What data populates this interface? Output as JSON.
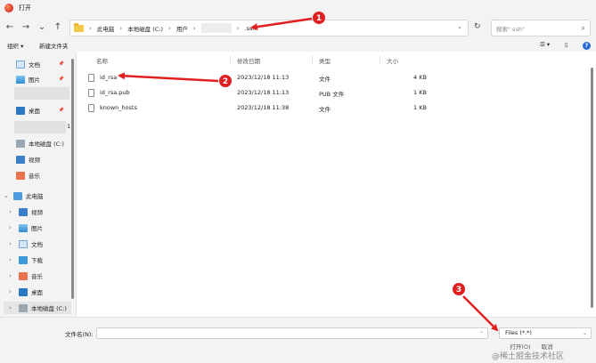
{
  "window": {
    "title": "打开"
  },
  "nav": {
    "back": "←",
    "forward": "→",
    "dropdown": "⌄",
    "up": "↑"
  },
  "address": {
    "crumbs": [
      "此电脑",
      "本地磁盘 (C:)",
      "用户",
      ".ssh"
    ],
    "separator": "›",
    "redacted_crumb": "",
    "dropdown": "⌄",
    "refresh": "↻"
  },
  "search": {
    "placeholder": "搜索\".ssh\"",
    "icon": "search-icon"
  },
  "toolbar": {
    "organize": "组织 ▾",
    "new_folder": "新建文件夹",
    "view_menu": "☰ ▾",
    "preview": "▯",
    "help": "?"
  },
  "sidebar": {
    "quick_access": [
      {
        "label": "文档",
        "icon": "documents-icon",
        "pinned": true
      },
      {
        "label": "图片",
        "icon": "pictures-icon",
        "pinned": true
      },
      {
        "label": "桌面",
        "icon": "desktop-icon",
        "pinned": true
      },
      {
        "label": "本地磁盘 (C:)",
        "icon": "drive-icon",
        "pinned": false
      },
      {
        "label": "视频",
        "icon": "videos-icon",
        "pinned": false
      },
      {
        "label": "音乐",
        "icon": "music-icon",
        "pinned": false
      }
    ],
    "stray_char": "1",
    "this_pc": {
      "label": "此电脑",
      "icon": "computer-icon"
    },
    "pc_children": [
      {
        "label": "视频",
        "icon": "videos-icon"
      },
      {
        "label": "图片",
        "icon": "pictures-icon"
      },
      {
        "label": "文档",
        "icon": "documents-icon"
      },
      {
        "label": "下载",
        "icon": "downloads-icon"
      },
      {
        "label": "音乐",
        "icon": "music-icon"
      },
      {
        "label": "桌面",
        "icon": "desktop-icon"
      },
      {
        "label": "本地磁盘 (C:)",
        "icon": "drive-icon"
      }
    ],
    "pin_glyph": "📌",
    "expand_glyph": "›",
    "collapse_glyph": "⌄"
  },
  "columns": {
    "name": "名称",
    "modified": "修改日期",
    "type": "类型",
    "size": "大小"
  },
  "files": [
    {
      "name": "id_rsa",
      "modified": "2023/12/18 11:13",
      "type": "文件",
      "size": "4 KB"
    },
    {
      "name": "id_rsa.pub",
      "modified": "2023/12/18 11:13",
      "type": "PUB 文件",
      "size": "1 KB"
    },
    {
      "name": "known_hosts",
      "modified": "2023/12/18 11:38",
      "type": "文件",
      "size": "1 KB"
    }
  ],
  "bottom": {
    "filename_label": "文件名(N):",
    "filename_value": "",
    "filetype_value": "Files (*.*)",
    "open_button": "打开(O)",
    "cancel_button": "取消",
    "dropdown": "⌄"
  },
  "watermark": "@稀土掘金技术社区",
  "annotations": {
    "color": "#e02020",
    "badges": [
      "1",
      "2",
      "3"
    ]
  }
}
